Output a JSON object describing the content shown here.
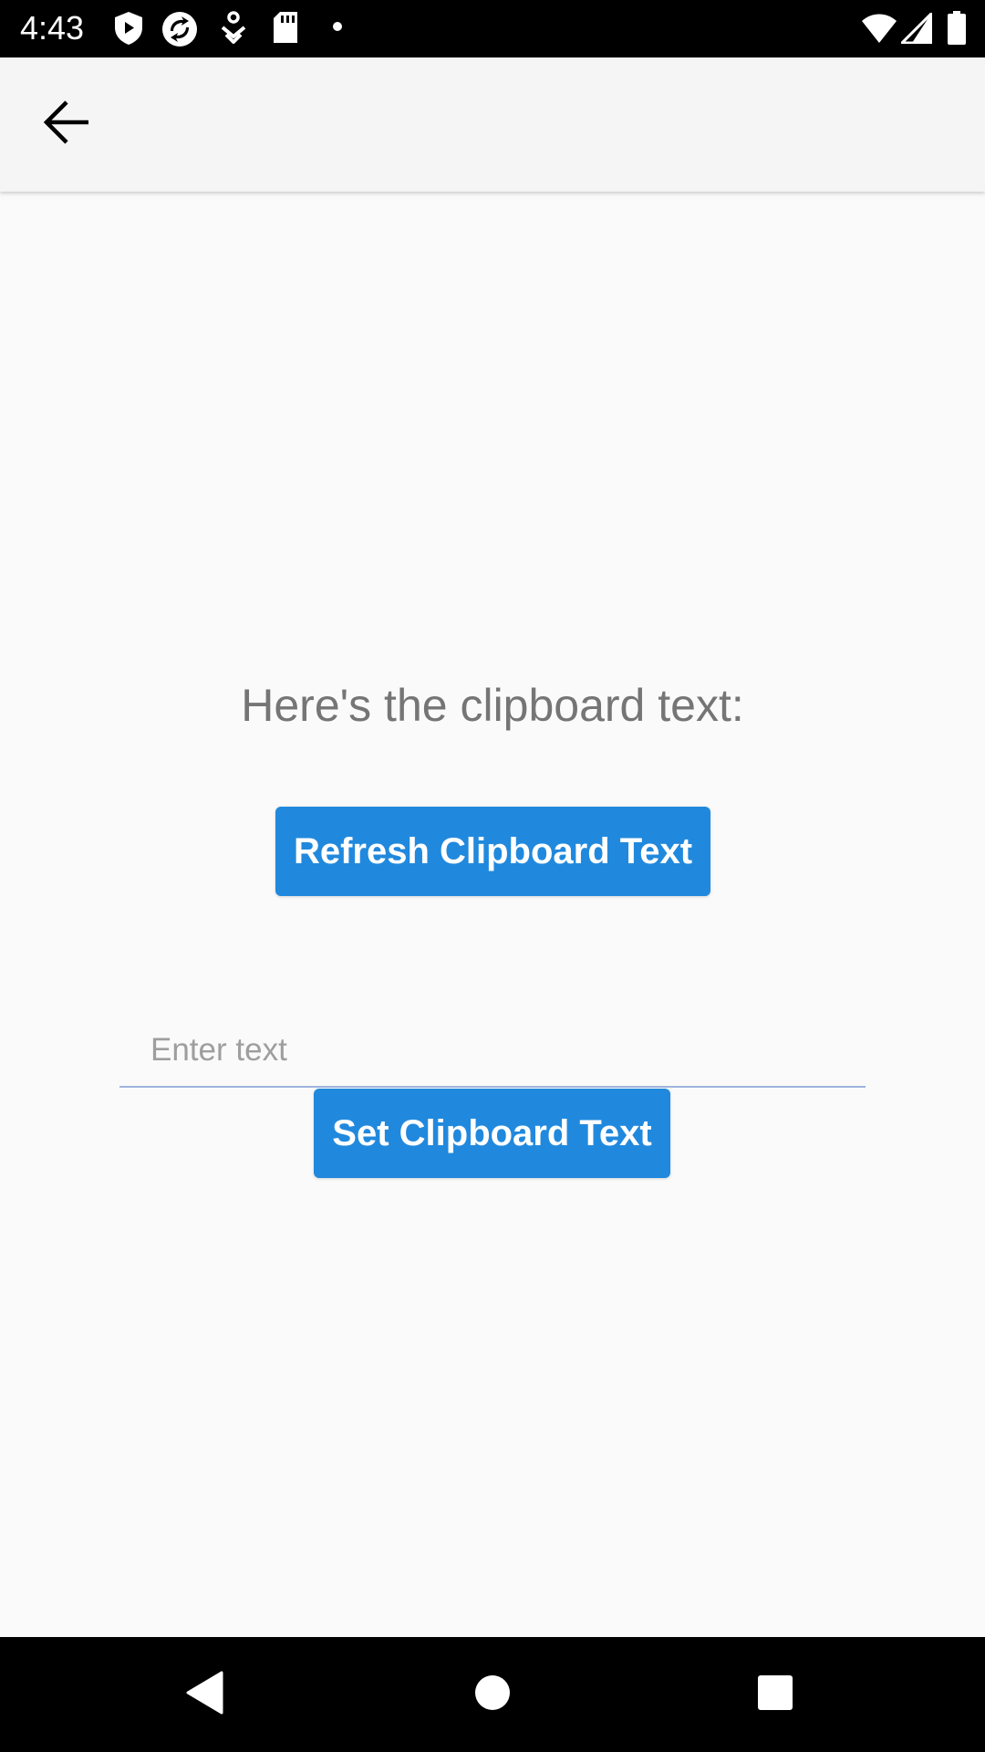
{
  "status_bar": {
    "time": "4:43",
    "icons": [
      "play-protect-icon",
      "sync-icon",
      "accessibility-icon",
      "sd-card-icon",
      "dot-icon",
      "wifi-icon",
      "signal-icon",
      "battery-icon"
    ]
  },
  "app_bar": {
    "back_icon": "arrow-back-icon"
  },
  "main": {
    "heading": "Here's the clipboard text:",
    "refresh_button": "Refresh Clipboard Text",
    "input": {
      "value": "",
      "placeholder": "Enter text"
    },
    "set_button": "Set Clipboard Text"
  },
  "nav_bar": {
    "icons": [
      "back-triangle-icon",
      "home-circle-icon",
      "recents-square-icon"
    ]
  },
  "colors": {
    "accent": "#2189dd",
    "heading_text": "#757575",
    "background": "#fafafa",
    "app_bar": "#f5f5f5",
    "input_underline": "#9fb4e0"
  }
}
